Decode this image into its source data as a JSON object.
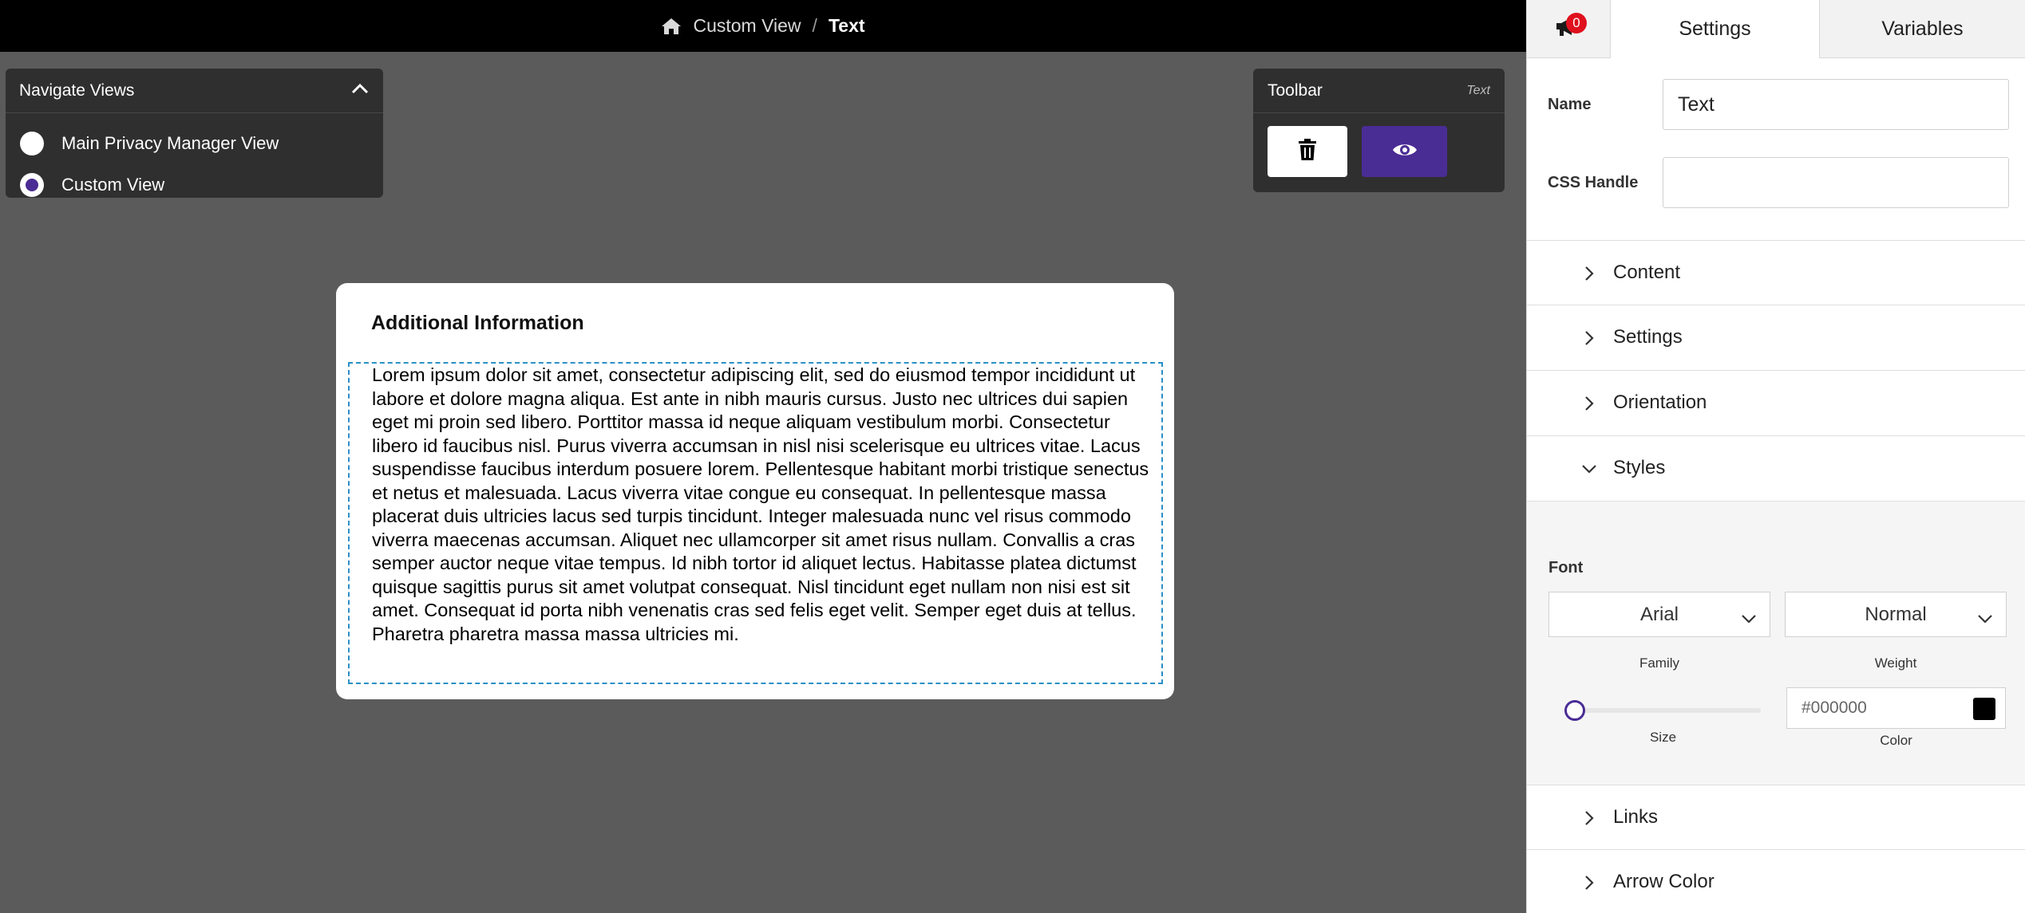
{
  "breadcrumb": {
    "parent": "Custom View",
    "separator": "/",
    "current": "Text"
  },
  "nav_panel": {
    "title": "Navigate Views",
    "options": [
      {
        "label": "Main Privacy Manager View",
        "selected": false
      },
      {
        "label": "Custom View",
        "selected": true
      }
    ]
  },
  "toolbar": {
    "title": "Toolbar",
    "context": "Text"
  },
  "card": {
    "title": "Additional Information",
    "body": "Lorem ipsum dolor sit amet, consectetur adipiscing elit, sed do eiusmod tempor incididunt ut labore et dolore magna aliqua. Est ante in nibh mauris cursus. Justo nec ultrices dui sapien eget mi proin sed libero. Porttitor massa id neque aliquam vestibulum morbi. Consectetur libero id faucibus nisl. Purus viverra accumsan in nisl nisi scelerisque eu ultrices vitae. Lacus suspendisse faucibus interdum posuere lorem. Pellentesque habitant morbi tristique senectus et netus et malesuada. Lacus viverra vitae congue eu consequat. In pellentesque massa placerat duis ultricies lacus sed turpis tincidunt. Integer malesuada nunc vel risus commodo viverra maecenas accumsan. Aliquet nec ullamcorper sit amet risus nullam. Convallis a cras semper auctor neque vitae tempus. Id nibh tortor id aliquet lectus. Habitasse platea dictumst quisque sagittis purus sit amet volutpat consequat. Nisl tincidunt eget nullam non nisi est sit amet. Consequat id porta nibh venenatis cras sed felis eget velit. Semper eget duis at tellus. Pharetra pharetra massa massa ultricies mi."
  },
  "right_panel": {
    "notification_count": "0",
    "tabs": {
      "settings": "Settings",
      "variables": "Variables"
    },
    "name": {
      "label": "Name",
      "value": "Text"
    },
    "css_handle": {
      "label": "CSS Handle",
      "value": ""
    },
    "sections": {
      "content": "Content",
      "settings": "Settings",
      "orientation": "Orientation",
      "styles": "Styles",
      "links": "Links",
      "arrow_color": "Arrow Color"
    },
    "styles": {
      "font_label": "Font",
      "family_value": "Arial",
      "family_label": "Family",
      "weight_value": "Normal",
      "weight_label": "Weight",
      "size_label": "Size",
      "size_fraction": 0.05,
      "color_value": "#000000",
      "color_label": "Color"
    }
  },
  "colors": {
    "accent": "#4a2c95",
    "selection_border": "#2b8fc7",
    "badge": "#e0101e"
  }
}
